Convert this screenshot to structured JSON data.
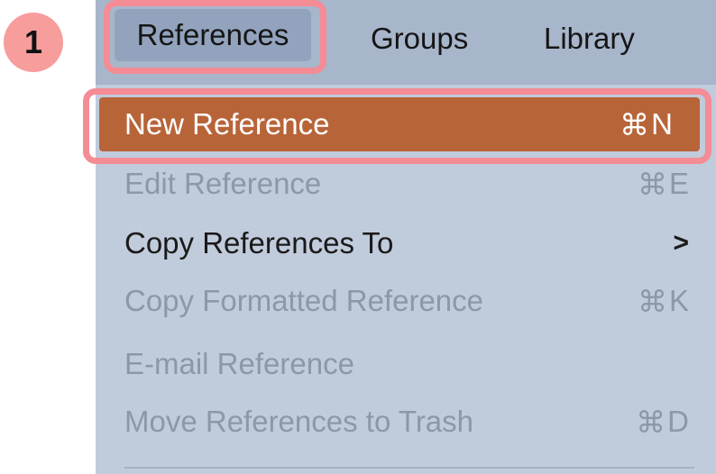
{
  "step_badge": "1",
  "menubar": {
    "menus": [
      "References",
      "Groups",
      "Library"
    ],
    "active": "References"
  },
  "dropdown": {
    "items": [
      {
        "label": "New Reference",
        "shortcut_symbol": "⌘",
        "shortcut_key": "N",
        "state": "selected"
      },
      {
        "label": "Edit Reference",
        "shortcut_symbol": "⌘",
        "shortcut_key": "E",
        "state": "disabled"
      },
      {
        "label": "Copy References To",
        "submenu_indicator": ">",
        "state": "enabled"
      },
      {
        "label": "Copy Formatted Reference",
        "shortcut_symbol": "⌘",
        "shortcut_key": "K",
        "state": "disabled"
      },
      {
        "label": "E-mail Reference",
        "state": "disabled"
      },
      {
        "label": "Move References to Trash",
        "shortcut_symbol": "⌘",
        "shortcut_key": "D",
        "state": "disabled"
      }
    ]
  },
  "colors": {
    "menubar_bg": "#a8b6cb",
    "menu_bg": "#c0cbdb",
    "selected_bg": "#b86439",
    "highlight_ring": "#f48c95",
    "badge_bg": "#f79d9c",
    "disabled_text": "#8c97a8"
  }
}
